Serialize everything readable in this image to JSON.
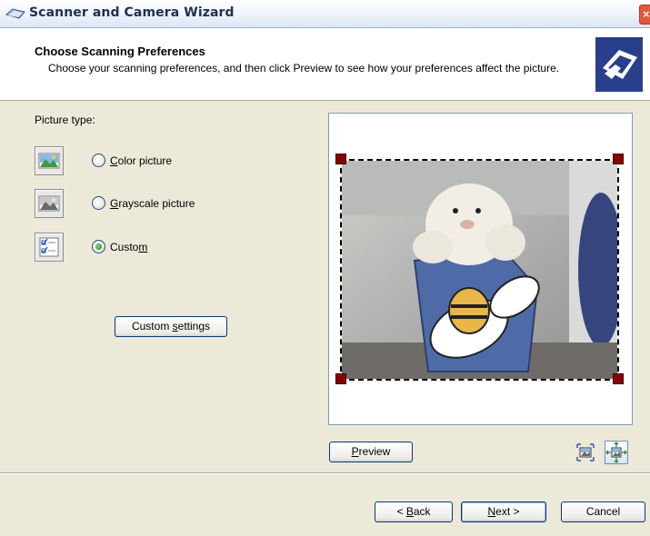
{
  "window": {
    "title": "Scanner and Camera Wizard",
    "close_icon": "close-icon"
  },
  "header": {
    "title": "Choose Scanning Preferences",
    "subtitle": "Choose your scanning preferences, and then click Preview to see how your preferences affect the picture."
  },
  "picture_type": {
    "label": "Picture type:",
    "options": [
      {
        "label_prefix": "",
        "mnemonic": "C",
        "label_rest": "olor picture",
        "selected": false
      },
      {
        "label_prefix": "",
        "mnemonic": "G",
        "label_rest": "rayscale picture",
        "selected": false
      },
      {
        "label_prefix": "Custo",
        "mnemonic": "m",
        "label_rest": "",
        "selected": true
      }
    ]
  },
  "custom_settings": {
    "prefix": "Custom ",
    "mnemonic": "s",
    "rest": "ettings"
  },
  "preview": {
    "prefix": "",
    "mnemonic": "P",
    "rest": "review"
  },
  "nav": {
    "back": {
      "prefix": "< ",
      "mnemonic": "B",
      "rest": "ack"
    },
    "next": {
      "prefix": "",
      "mnemonic": "N",
      "rest": "ext >"
    },
    "cancel": "Cancel"
  },
  "colors": {
    "handle": "#8b0000",
    "header_icon_bg": "#2a3f8c",
    "window_bg": "#ece9d8"
  }
}
